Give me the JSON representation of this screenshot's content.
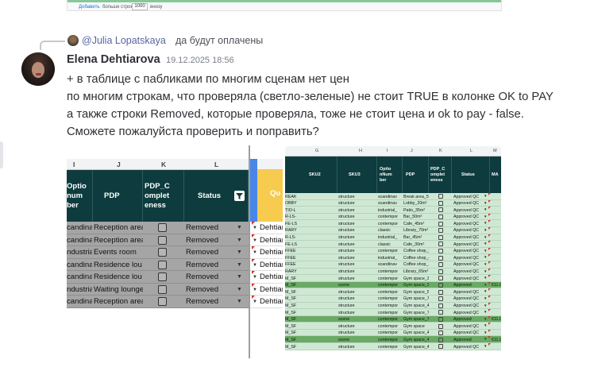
{
  "prev_attachment": {
    "add_label": "Добавить",
    "more_label": "больше строк",
    "rows_value": "1000",
    "bottom_label": "внизу"
  },
  "reply": {
    "name": "@Julia Lopatskaya",
    "text": "да будут оплачены"
  },
  "message": {
    "author": "Elena Dehtiarova",
    "timestamp": "19.12.2025 18:56",
    "lines": [
      "+ в таблице с пабликами по многим сценам нет цен",
      "по многим строкам, что проверяла (светло-зеленые) не стоит TRUE в колонке OK to PAY",
      "а также строки Removed, которые проверяла, тоже не стоит цена и ok to pay - false.",
      "Сможете пожалуйста проверить и поправить?"
    ]
  },
  "sheet1": {
    "col_letters": [
      "I",
      "J",
      "K",
      "L"
    ],
    "headers": {
      "optio": "Optio\nnum\nber",
      "pdp": "PDP",
      "pdp_completeness": "PDP_C\nomplet\neness",
      "status": "Status",
      "qu": "Qu"
    },
    "rows": [
      {
        "i": "candinav",
        "pdp": "Reception area",
        "status": "Removed",
        "qu": "Dehtiar"
      },
      {
        "i": "candinav",
        "pdp": "Reception area",
        "status": "Removed",
        "qu": "Dehtiar"
      },
      {
        "i": "ndustrial_",
        "pdp": "Events room",
        "status": "Removed",
        "qu": "Dehtiar"
      },
      {
        "i": "candinav",
        "pdp": "Residence lou",
        "status": "Removed",
        "qu": "Dehtiar"
      },
      {
        "i": "candinav",
        "pdp": "Residence lou",
        "status": "Removed",
        "qu": "Dehtiar"
      },
      {
        "i": "ndustrial_",
        "pdp": "Waiting lounge",
        "status": "Removed",
        "qu": "Dehtiar"
      },
      {
        "i": "candinav",
        "pdp": "Reception area",
        "status": "Removed",
        "qu": "Dehtiar"
      }
    ]
  },
  "sheet2": {
    "col_letters": [
      "G",
      "H",
      "I",
      "J",
      "K",
      "L",
      "M"
    ],
    "headers": {
      "sku2": "SKU2",
      "sku3": "SKU3",
      "option": "Optio\nnNum\nber",
      "pdp": "PDP",
      "pdp_c": "PDP_C\nomplet\neness",
      "status": "Status",
      "ma": "MA"
    },
    "rows": [
      {
        "sku2": "REAK",
        "sku3": "structure",
        "opt": "scandinav",
        "pdp": "Break area_50",
        "status": "Approved QC",
        "last": "",
        "green": false
      },
      {
        "sku2": "OBBY",
        "sku3": "structure",
        "opt": "scandinav",
        "pdp": "Lobby_20m²",
        "status": "Approved QC",
        "last": "",
        "green": false
      },
      {
        "sku2": "TIO-L",
        "sku3": "structure",
        "opt": "industrial_",
        "pdp": "Patio_35m²",
        "status": "Approved QC",
        "last": "",
        "green": false
      },
      {
        "sku2": "R-LS-",
        "sku3": "structure",
        "opt": "contempor",
        "pdp": "Bar_50m²",
        "status": "Approved QC",
        "last": "",
        "green": false
      },
      {
        "sku2": "FE-LS",
        "sku3": "structure",
        "opt": "contempor",
        "pdp": "Cafe_45m²",
        "status": "Approved QC",
        "last": "",
        "green": false
      },
      {
        "sku2": "RARY",
        "sku3": "structure",
        "opt": "classic",
        "pdp": "Library_70m²",
        "status": "Approved QC",
        "last": "",
        "green": false
      },
      {
        "sku2": "R-LS-",
        "sku3": "structure",
        "opt": "industrial_",
        "pdp": "Bar_45m²",
        "status": "Approved QC",
        "last": "",
        "green": false
      },
      {
        "sku2": "FE-LS",
        "sku3": "structure",
        "opt": "classic",
        "pdp": "Cafe_30m²",
        "status": "Approved QC",
        "last": "",
        "green": false
      },
      {
        "sku2": "FFEE",
        "sku3": "structure",
        "opt": "contempor",
        "pdp": "Coffee shop_3",
        "status": "Approved QC",
        "last": "",
        "green": false
      },
      {
        "sku2": "FFEE",
        "sku3": "structure",
        "opt": "industrial_",
        "pdp": "Coffee shop_4",
        "status": "Approved QC",
        "last": "",
        "green": false
      },
      {
        "sku2": "FFEE",
        "sku3": "structure",
        "opt": "scandinav",
        "pdp": "Coffee shop_1",
        "status": "Approved QC",
        "last": "",
        "green": false
      },
      {
        "sku2": "RARY",
        "sku3": "structure",
        "opt": "contempor",
        "pdp": "Library_65m²",
        "status": "Approved QC",
        "last": "",
        "green": false
      },
      {
        "sku2": "M_SF",
        "sku3": "structure",
        "opt": "contempor",
        "pdp": "Gym space_3(",
        "status": "Approved QC",
        "last": "",
        "green": false
      },
      {
        "sku2": "M_SF",
        "sku3": "scene",
        "opt": "contempor",
        "pdp": "Gym space_3(",
        "status": "Approved",
        "last": "€11.0",
        "green": true
      },
      {
        "sku2": "M_SF",
        "sku3": "structure",
        "opt": "contempor",
        "pdp": "Gym space_5(",
        "status": "Approved QC",
        "last": "",
        "green": false
      },
      {
        "sku2": "M_SF",
        "sku3": "structure",
        "opt": "contempor",
        "pdp": "Gym space_7(",
        "status": "Approved QC",
        "last": "",
        "green": false
      },
      {
        "sku2": "M_SF",
        "sku3": "structure",
        "opt": "contempor",
        "pdp": "Gym space_4(",
        "status": "Approved QC",
        "last": "",
        "green": false
      },
      {
        "sku2": "M_SF",
        "sku3": "structure",
        "opt": "contempor",
        "pdp": "Gym space_7(",
        "status": "Approved QC",
        "last": "",
        "green": false
      },
      {
        "sku2": "M_SF",
        "sku3": "scene",
        "opt": "contempor",
        "pdp": "Gym space_7(",
        "status": "Approved",
        "last": "€11.0",
        "green": true
      },
      {
        "sku2": "M_SF",
        "sku3": "structure",
        "opt": "contempor",
        "pdp": "Gym space",
        "status": "Approved QC",
        "last": "",
        "green": false
      },
      {
        "sku2": "M_SF",
        "sku3": "structure",
        "opt": "contempor",
        "pdp": "Gym space_4(",
        "status": "Approved QC",
        "last": "",
        "green": false
      },
      {
        "sku2": "M_SF",
        "sku3": "scene",
        "opt": "contempor",
        "pdp": "Gym space_4(",
        "status": "Approved",
        "last": "€11.0",
        "green": true
      },
      {
        "sku2": "M_SF",
        "sku3": "structure",
        "opt": "contempor",
        "pdp": "Gym space_4(",
        "status": "Approved QC",
        "last": "",
        "green": false
      }
    ]
  },
  "colors": {
    "header_bg": "#0e3c3e",
    "removed_row": "#a5a5a5",
    "light_green_row": "#cfe8d4",
    "green_row": "#6aaa64",
    "yellow_header": "#f7cb4d"
  }
}
